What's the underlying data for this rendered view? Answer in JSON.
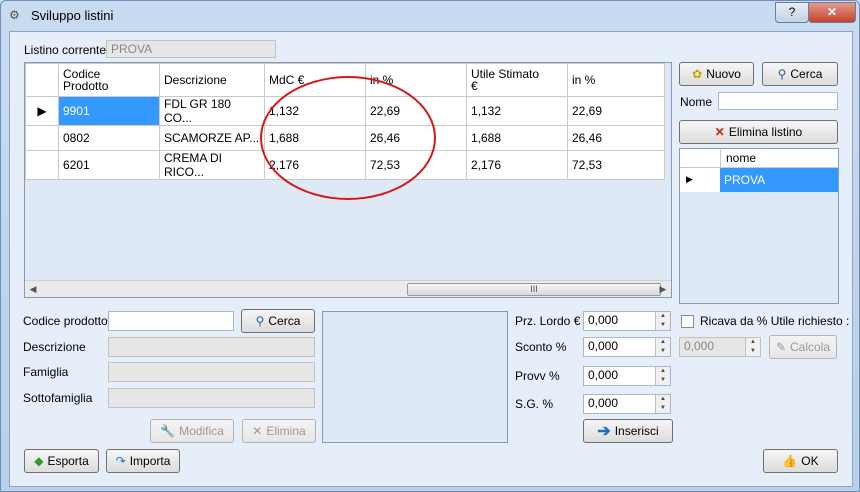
{
  "window": {
    "title": "Sviluppo listini",
    "help": "?",
    "close": "✕"
  },
  "listino": {
    "label": "Listino corrente",
    "value": "PROVA"
  },
  "grid": {
    "headers": [
      "Codice\nProdotto",
      "Descrizione",
      "MdC €",
      "in %",
      "Utile Stimato\n€",
      "in %"
    ],
    "rows": [
      [
        "9901",
        "FDL GR 180 CO...",
        "1,132",
        "22,69",
        "1,132",
        "22,69"
      ],
      [
        "0802",
        "SCAMORZE AP...",
        "1,688",
        "26,46",
        "1,688",
        "26,46"
      ],
      [
        "6201",
        "CREMA DI RICO...",
        "2,176",
        "72,53",
        "2,176",
        "72,53"
      ]
    ],
    "scroll_grip": "III"
  },
  "right_panel": {
    "nuovo": "Nuovo",
    "cerca": "Cerca",
    "nome_label": "Nome",
    "nome_value": "",
    "elimina": "Elimina listino",
    "list_header": "nome",
    "list_items": [
      "PROVA"
    ]
  },
  "product_form": {
    "codice_label": "Codice prodotto",
    "codice_value": "",
    "cerca": "Cerca",
    "descrizione_label": "Descrizione",
    "famiglia_label": "Famiglia",
    "sottofamiglia_label": "Sottofamiglia",
    "modifica": "Modifica",
    "elimina": "Elimina"
  },
  "pricing": {
    "prz_lordo_label": "Prz. Lordo €",
    "prz_lordo": "0,000",
    "sconto_label": "Sconto %",
    "sconto": "0,000",
    "provv_label": "Provv %",
    "provv": "0,000",
    "sg_label": "S.G. %",
    "sg": "0,000",
    "inserisci": "Inserisci",
    "ricava_label": "Ricava da % Utile richiesto :",
    "ricava_value": "0,000",
    "calcola": "Calcola"
  },
  "footer": {
    "esporta": "Esporta",
    "importa": "Importa",
    "ok": "OK"
  }
}
